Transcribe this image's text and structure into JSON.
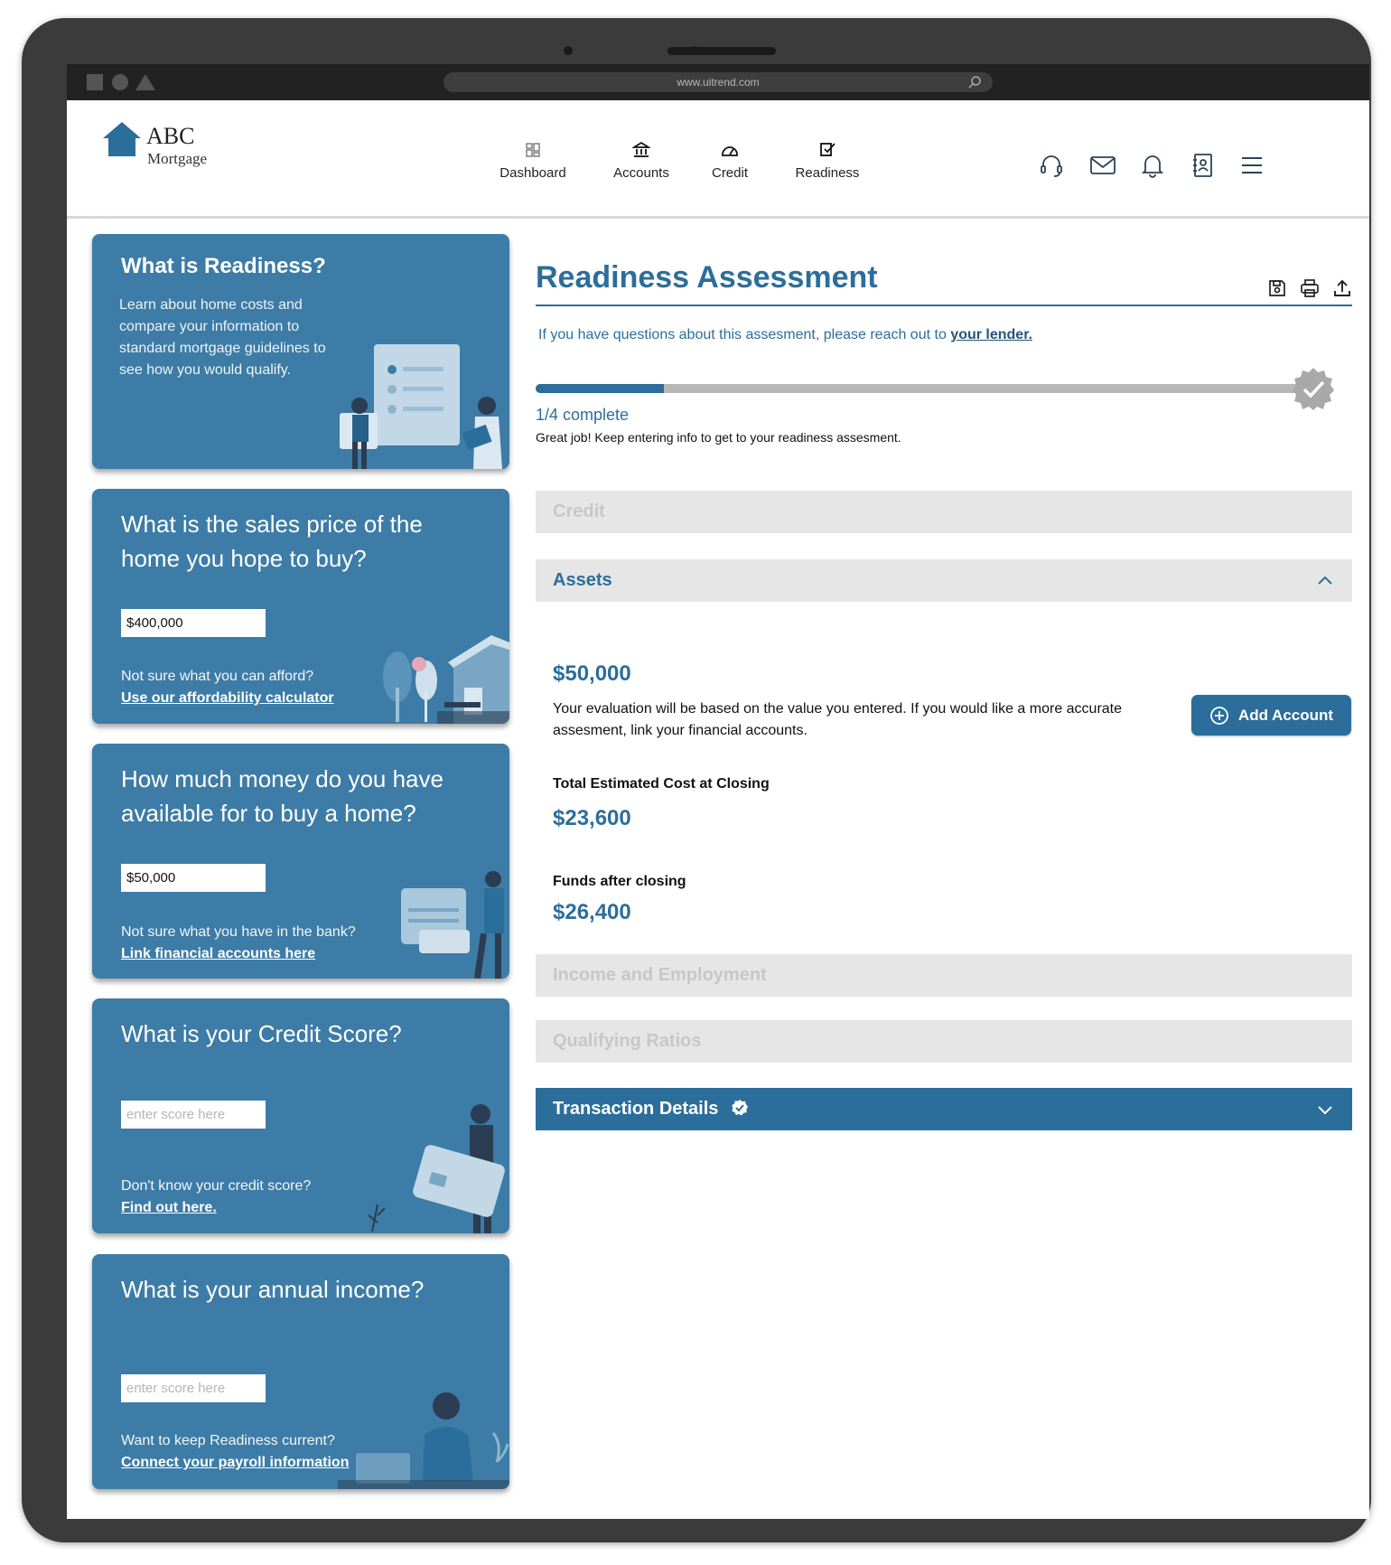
{
  "browser": {
    "url": "www.uitrend.com"
  },
  "brand": {
    "line1": "ABC",
    "line2": "Mortgage"
  },
  "nav": [
    {
      "label": "Dashboard",
      "icon": "dashboard-icon"
    },
    {
      "label": "Accounts",
      "icon": "bank-icon"
    },
    {
      "label": "Credit",
      "icon": "gauge-icon"
    },
    {
      "label": "Readiness",
      "icon": "checklist-icon"
    }
  ],
  "header_icons": [
    "headset-icon",
    "mail-icon",
    "bell-icon",
    "contacts-icon",
    "menu-icon"
  ],
  "cards": {
    "readiness": {
      "title": "What is Readiness?",
      "description": "Learn about home costs and compare your information to standard mortgage guidelines to see how you would qualify."
    },
    "sales_price": {
      "question": "What is the sales price of the home you hope to buy?",
      "value": "$400,000",
      "hint": "Not sure what you can afford?",
      "link": "Use our affordability calculator"
    },
    "money": {
      "question": "How much money do you have available for to buy a home?",
      "value": "$50,000",
      "hint": "Not sure what you have in the bank?",
      "link": "Link financial accounts here"
    },
    "credit": {
      "question": "What is your Credit Score?",
      "placeholder": "enter score here",
      "hint": "Don't know your credit score?",
      "link": "Find out here."
    },
    "income": {
      "question": "What is your annual income?",
      "placeholder": "enter score here",
      "hint": "Want to keep Readiness current?",
      "link": "Connect your payroll information"
    }
  },
  "main": {
    "title": "Readiness Assessment",
    "lender_note": "If you have questions about this assesment, please reach out to",
    "lender_link": "your lender.",
    "progress": {
      "fraction": 0.165,
      "label": "1/4 complete",
      "message": "Great job! Keep entering info to get to your readiness assesment."
    },
    "sections": {
      "credit": "Credit",
      "assets": "Assets",
      "income": "Income and Employment",
      "ratios": "Qualifying Ratios",
      "transaction": "Transaction Details"
    },
    "assets": {
      "value": "$50,000",
      "description": "Your evaluation will be based on the value you entered. If you would like a more accurate assesment, link your financial accounts.",
      "add_button": "Add Account",
      "closing_label": "Total Estimated Cost at Closing",
      "closing_value": "$23,600",
      "funds_label": "Funds after closing",
      "funds_value": "$26,400"
    }
  },
  "colors": {
    "primary": "#2c6e9b",
    "card": "#3d7ca6",
    "section_bg": "#e6e6e6"
  }
}
